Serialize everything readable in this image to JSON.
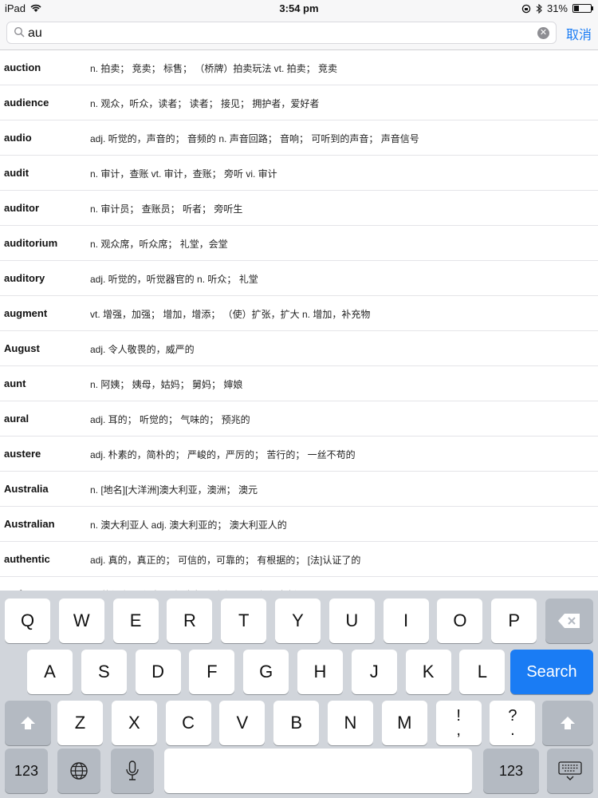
{
  "status": {
    "device": "iPad",
    "time": "3:54 pm",
    "battery": "31%",
    "battery_fraction": 0.31
  },
  "search": {
    "value": "au",
    "cancel_label": "取消"
  },
  "entries": [
    {
      "word": "auction",
      "def": "n. 拍卖； 竞卖； 标售； （桥牌）拍卖玩法 vt. 拍卖； 竞卖"
    },
    {
      "word": "audience",
      "def": "n. 观众，听众，读者； 读者； 接见； 拥护者，爱好者"
    },
    {
      "word": "audio",
      "def": "adj. 听觉的，声音的； 音频的 n. 声音回路； 音响； 可听到的声音； 声音信号"
    },
    {
      "word": "audit",
      "def": "n. 审计，查账 vt. 审计，查账； 旁听 vi. 审计"
    },
    {
      "word": "auditor",
      "def": "n. 审计员； 查账员； 听者； 旁听生"
    },
    {
      "word": "auditorium",
      "def": "n. 观众席，听众席； 礼堂，会堂"
    },
    {
      "word": "auditory",
      "def": "adj. 听觉的，听觉器官的 n. 听众； 礼堂"
    },
    {
      "word": "augment",
      "def": "vt. 增强，加强； 增加，增添； （使）扩张，扩大 n. 增加，补充物"
    },
    {
      "word": "August",
      "def": "adj. 令人敬畏的，威严的"
    },
    {
      "word": "aunt",
      "def": "n. 阿姨； 姨母，姑妈； 舅妈； 婶娘"
    },
    {
      "word": "aural",
      "def": "adj. 耳的； 听觉的； 气味的； 预兆的"
    },
    {
      "word": "austere",
      "def": "adj. 朴素的，简朴的； 严峻的，严厉的； 苦行的； 一丝不苟的"
    },
    {
      "word": "Australia",
      "def": "n. [地名][大洋洲]澳大利亚，澳洲； 澳元"
    },
    {
      "word": "Australian",
      "def": "n. 澳大利亚人 adj. 澳大利亚的； 澳大利亚人的"
    },
    {
      "word": "authentic",
      "def": "adj. 真的，真正的； 可信的，可靠的； 有根据的； [法]认证了的"
    },
    {
      "word": "author",
      "def": "n. 著作家； 作者； 创造者； 发起人 vt. 创作出版"
    }
  ],
  "keyboard": {
    "row1": [
      "Q",
      "W",
      "E",
      "R",
      "T",
      "Y",
      "U",
      "I",
      "O",
      "P"
    ],
    "row2": [
      "A",
      "S",
      "D",
      "F",
      "G",
      "H",
      "J",
      "K",
      "L"
    ],
    "row3": [
      "Z",
      "X",
      "C",
      "V",
      "B",
      "N",
      "M",
      "!\n,",
      "?\n."
    ],
    "search_label": "Search",
    "numbers_label": "123",
    "icons": [
      "backspace-icon",
      "shift-icon",
      "globe-icon",
      "microphone-icon",
      "keyboard-dismiss-icon"
    ]
  }
}
